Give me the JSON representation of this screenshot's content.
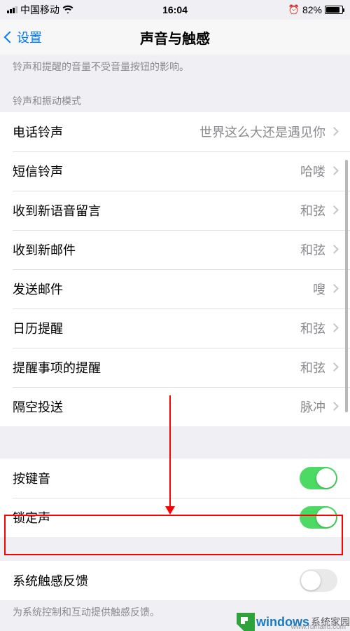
{
  "status": {
    "carrier": "中国移动",
    "time": "16:04",
    "battery_pct": "82%"
  },
  "nav": {
    "back": "设置",
    "title": "声音与触感"
  },
  "notes": {
    "top_truncated": "铃声和提醒的音量不受音量按钮的影响。",
    "section1": "铃声和振动模式",
    "haptics": "为系统控制和互动提供触感反馈。"
  },
  "rows": {
    "ringtone": {
      "label": "电话铃声",
      "value": "世界这么大还是遇见你"
    },
    "texttone": {
      "label": "短信铃声",
      "value": "哈喽"
    },
    "voicemail": {
      "label": "收到新语音留言",
      "value": "和弦"
    },
    "newmail": {
      "label": "收到新邮件",
      "value": "和弦"
    },
    "sentmail": {
      "label": "发送邮件",
      "value": "嗖"
    },
    "calendar": {
      "label": "日历提醒",
      "value": "和弦"
    },
    "reminders": {
      "label": "提醒事项的提醒",
      "value": "和弦"
    },
    "airdrop": {
      "label": "隔空投送",
      "value": "脉冲"
    }
  },
  "toggles": {
    "keyclicks": {
      "label": "按键音",
      "on": true
    },
    "locksound": {
      "label": "锁定声",
      "on": true
    },
    "haptics": {
      "label": "系统触感反馈",
      "on": false
    }
  },
  "watermark": {
    "brand1": "windows",
    "brand2": "系统家园",
    "url": "www.ruihaifu.com"
  }
}
